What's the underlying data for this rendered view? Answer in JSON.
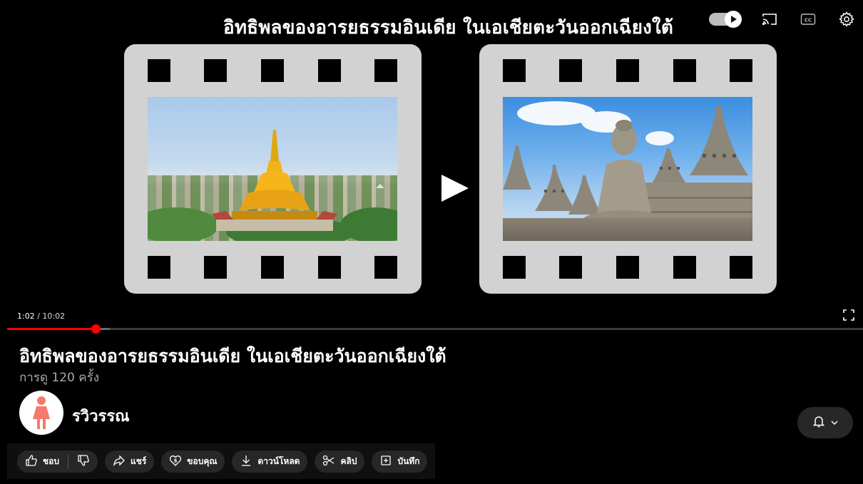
{
  "player": {
    "title": "อิทธิพลของอารยธรรมอินเดีย ในเอเชียตะวันออกเฉียงใต้",
    "current_time": "1:02",
    "time_separator": " / ",
    "duration": "10:02",
    "progress_fraction": 0.103,
    "buffer_fraction": 0.12,
    "controls": {
      "autoplay_icon": "autoplay-toggle-icon",
      "cast_icon": "cast-icon",
      "captions_icon": "captions-icon",
      "settings_icon": "gear-icon",
      "fullscreen_icon": "fullscreen-icon"
    },
    "thumbnails": [
      {
        "name": "pagoda-image"
      },
      {
        "name": "borobudur-image"
      }
    ]
  },
  "video": {
    "title": "อิทธิพลของอารยธรรมอินเดีย ในเอเชียตะวันออกเฉียงใต้",
    "views": "การดู 120 ครั้ง"
  },
  "channel": {
    "name": "รวิวรรณ"
  },
  "actions": {
    "like": "ชอบ",
    "share": "แชร์",
    "thanks": "ขอบคุณ",
    "download": "ดาวน์โหลด",
    "clip": "คลิป",
    "save": "บันทึก"
  },
  "colors": {
    "progress": "#ff0000",
    "pill_bg": "#272727",
    "film": "#d2d2d2"
  }
}
